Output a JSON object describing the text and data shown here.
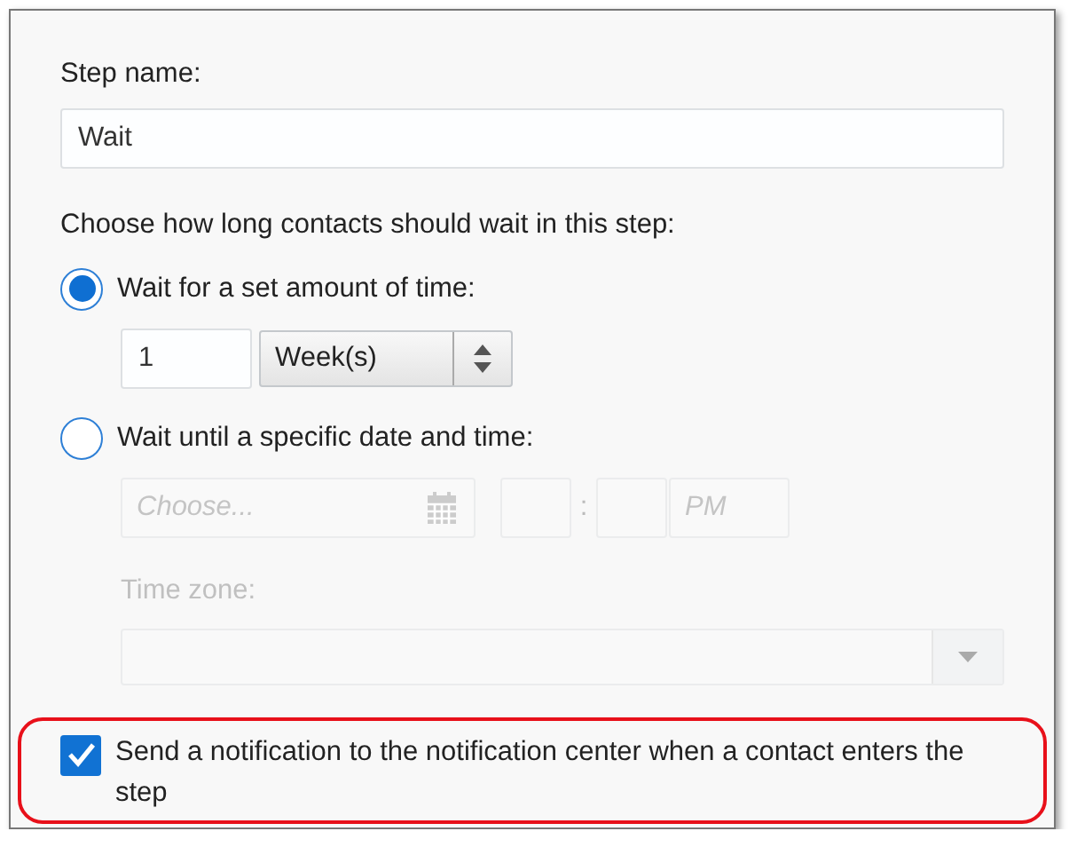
{
  "step_name": {
    "label": "Step name:",
    "value": "Wait"
  },
  "wait_prompt": "Choose how long contacts should wait in this step:",
  "options": [
    {
      "kind": "duration",
      "label": "Wait for a set amount of time:",
      "selected": true,
      "amount": "1",
      "unit": "Week(s)"
    },
    {
      "kind": "datetime",
      "label": "Wait until a specific date and time:",
      "selected": false,
      "disabled": true,
      "date_placeholder": "Choose...",
      "separator": ":",
      "ampm_placeholder": "PM",
      "timezone_label": "Time zone:"
    }
  ],
  "notification": {
    "label": "Send a notification to the notification center when a contact enters the step",
    "checked": true,
    "highlighted": true
  }
}
